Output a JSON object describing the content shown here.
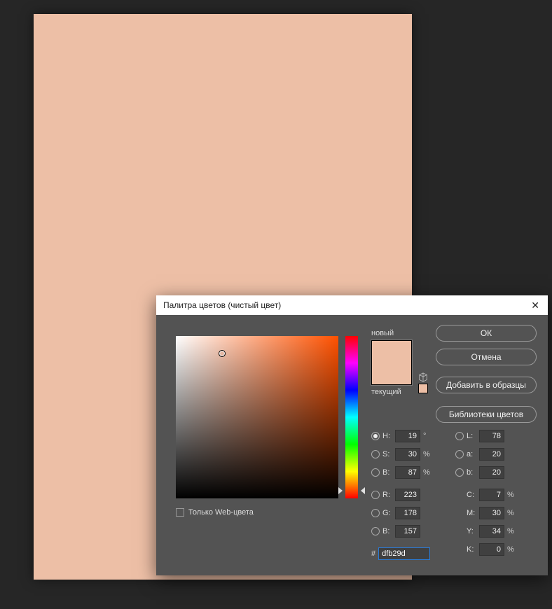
{
  "canvas": {
    "color": "#edbfa6"
  },
  "dialog": {
    "title": "Палитра цветов (чистый цвет)",
    "labels": {
      "new": "новый",
      "current": "текущий"
    },
    "buttons": {
      "ok": "ОК",
      "cancel": "Отмена",
      "add_swatch": "Добавить в образцы",
      "libraries": "Библиотеки цветов"
    },
    "web_only": {
      "label": "Только Web-цвета",
      "checked": false
    },
    "hsb": {
      "h": {
        "label": "H:",
        "value": "19",
        "unit": "°",
        "selected": true
      },
      "s": {
        "label": "S:",
        "value": "30",
        "unit": "%",
        "selected": false
      },
      "b": {
        "label": "B:",
        "value": "87",
        "unit": "%",
        "selected": false
      }
    },
    "rgb": {
      "r": {
        "label": "R:",
        "value": "223",
        "selected": false
      },
      "g": {
        "label": "G:",
        "value": "178",
        "selected": false
      },
      "b": {
        "label": "B:",
        "value": "157",
        "selected": false
      }
    },
    "lab": {
      "l": {
        "label": "L:",
        "value": "78",
        "selected": false
      },
      "a": {
        "label": "a:",
        "value": "20",
        "selected": false
      },
      "b": {
        "label": "b:",
        "value": "20",
        "selected": false
      }
    },
    "cmyk": {
      "c": {
        "label": "C:",
        "value": "7",
        "unit": "%"
      },
      "m": {
        "label": "M:",
        "value": "30",
        "unit": "%"
      },
      "y": {
        "label": "Y:",
        "value": "34",
        "unit": "%"
      },
      "k": {
        "label": "K:",
        "value": "0",
        "unit": "%"
      }
    },
    "hex": {
      "label": "#",
      "value": "dfb29d"
    },
    "preview": {
      "new_color": "#edbfa6",
      "current_color": "#edbfa6"
    }
  }
}
